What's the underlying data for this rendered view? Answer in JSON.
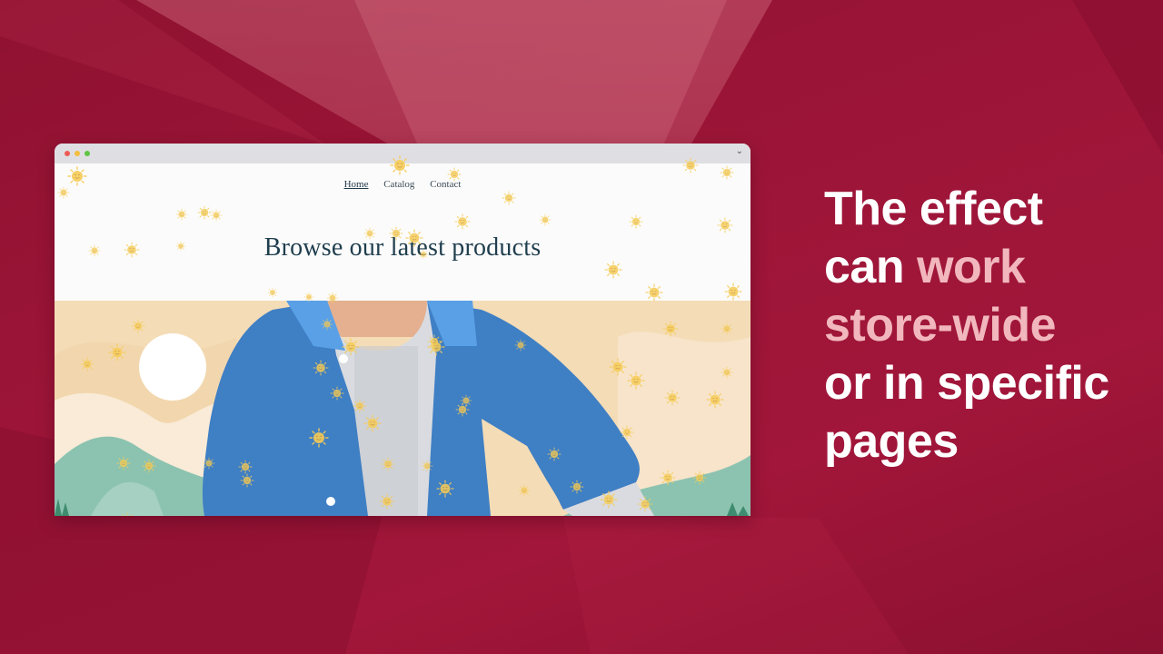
{
  "background": {
    "color": "#9b1236"
  },
  "browser_window": {
    "traffic_lights": [
      "close",
      "minimize",
      "maximize"
    ],
    "chevron_icon": "chevron-down-icon"
  },
  "store": {
    "nav": [
      {
        "label": "Home",
        "active": true
      },
      {
        "label": "Catalog",
        "active": false
      },
      {
        "label": "Contact",
        "active": false
      }
    ],
    "headline": "Browse our latest products",
    "hero_image": "illustration-man-in-denim-jacket",
    "effect_icon": "smiling-sun-icon"
  },
  "tagline": {
    "part1": "The effect",
    "part2": "can ",
    "highlight1": "work",
    "highlight2": "store-wide",
    "part3": "or in specific",
    "part4": "pages",
    "text_color": "#ffffff",
    "highlight_color": "#f1b7bd"
  }
}
